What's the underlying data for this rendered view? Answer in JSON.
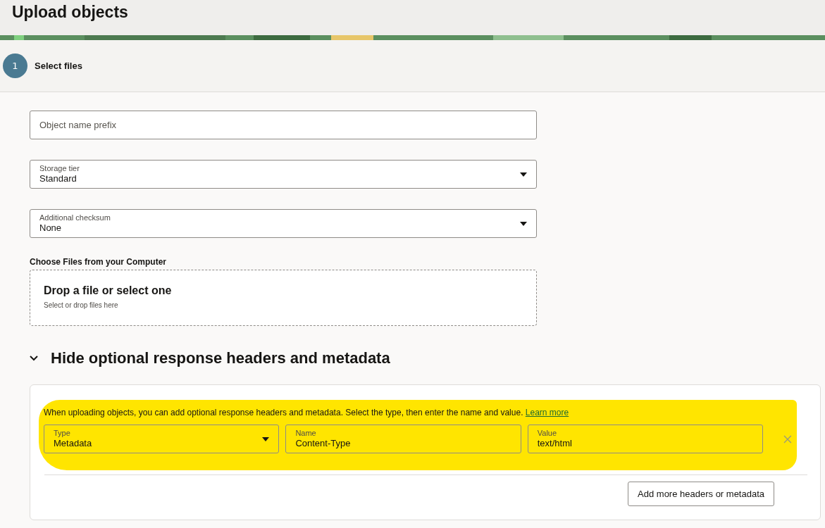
{
  "title": "Upload objects",
  "step": {
    "number": "1",
    "label": "Select files"
  },
  "fields": [
    {
      "kind": "text",
      "placeholder": "Object name prefix"
    },
    {
      "kind": "select",
      "label": "Storage tier",
      "value": "Standard"
    },
    {
      "kind": "select",
      "label": "Additional checksum",
      "value": "None"
    }
  ],
  "upload": {
    "label": "Choose Files from your Computer",
    "title": "Drop a file or select one",
    "hint": "Select or drop files here"
  },
  "optional_section": {
    "label": "Hide optional response headers and metadata",
    "expanded": true,
    "description": "When uploading objects, you can add optional response headers and metadata. Select the type, then enter the name and value.",
    "link": "Learn more",
    "row": [
      {
        "kind": "select",
        "label": "Type",
        "value": "Metadata"
      },
      {
        "kind": "text",
        "label": "Name",
        "value": "Content-Type"
      },
      {
        "kind": "text",
        "label": "Value",
        "value": "text/html"
      }
    ],
    "add_button": "Add more headers or metadata"
  }
}
